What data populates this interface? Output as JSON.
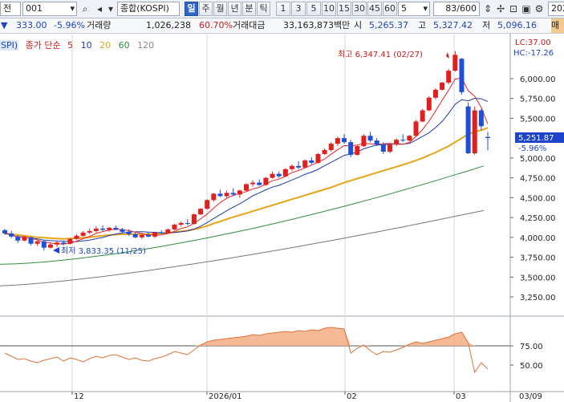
{
  "toolbar": {
    "mode_label": "전",
    "code": "001",
    "index_name": "종합(KOSPI)",
    "periods": [
      "일",
      "주",
      "월",
      "년",
      "분",
      "틱"
    ],
    "active_period": "일",
    "intervals": [
      "1",
      "3",
      "5",
      "10",
      "15",
      "30",
      "45",
      "60"
    ],
    "interval_value": "5",
    "count": "83/600",
    "date_cut": "202"
  },
  "quote": {
    "marker": "▼",
    "change": "333.00",
    "change_pct": "-5.96%",
    "volume_label": "거래량",
    "volume": "1,026,238",
    "volume_ratio": "60.70%",
    "amount_label": "거래대금",
    "amount": "33,163,873백만",
    "open_label": "시",
    "open": "5,265.37",
    "high_label": "고",
    "high": "5,327.42",
    "low_label": "저",
    "low": "5,096.16",
    "right_cut": "매"
  },
  "legend": {
    "tag": "SPI)",
    "ma_prefix": "종가 단순",
    "ma_periods": [
      "5",
      "10",
      "20",
      "60",
      "120"
    ]
  },
  "colors": {
    "up": "#e0201e",
    "down": "#1e4fd6",
    "ma5": "#e32626",
    "ma10": "#1f3aa8",
    "ma20": "#e8a418",
    "ma60": "#2e8f3a",
    "ma120": "#777777",
    "osc_fill": "#f4ad84",
    "osc_line": "#e0743a"
  },
  "price_axis": {
    "labels": [
      "6,000.00",
      "5,750.00",
      "5,500.00",
      "5,000.00",
      "4,750.00",
      "4,500.00",
      "4,250.00",
      "4,000.00",
      "3,750.00",
      "3,500.00",
      "3,250.00"
    ],
    "lc": "LC:37.00",
    "hc": "HC:-17.26",
    "current": "5,251.87",
    "current_pct": "-5.96%"
  },
  "annotations": {
    "high": "최고 6,347.41 (02/27)",
    "low": "최저 3,833.35 (11/25)"
  },
  "osc_axis": {
    "labels": [
      "75.00",
      "50.00"
    ]
  },
  "date_axis": {
    "labels": [
      "12",
      "2026/01",
      "02",
      "03",
      "03/09"
    ]
  },
  "chart_data": {
    "type": "candlestick",
    "dates": [
      "11/17",
      "11/18",
      "11/19",
      "11/20",
      "11/21",
      "11/24",
      "11/25",
      "11/26",
      "11/27",
      "11/28",
      "12/01",
      "12/02",
      "12/03",
      "12/04",
      "12/05",
      "12/08",
      "12/09",
      "12/10",
      "12/11",
      "12/12",
      "12/15",
      "12/16",
      "12/17",
      "12/18",
      "12/19",
      "12/22",
      "12/23",
      "12/24",
      "12/26",
      "12/29",
      "12/30",
      "01/02",
      "01/05",
      "01/06",
      "01/07",
      "01/08",
      "01/09",
      "01/12",
      "01/13",
      "01/14",
      "01/15",
      "01/16",
      "01/19",
      "01/20",
      "01/21",
      "01/22",
      "01/23",
      "01/26",
      "01/27",
      "01/28",
      "01/29",
      "01/30",
      "02/02",
      "02/03",
      "02/04",
      "02/05",
      "02/06",
      "02/09",
      "02/10",
      "02/11",
      "02/12",
      "02/13",
      "02/18",
      "02/19",
      "02/20",
      "02/23",
      "02/24",
      "02/25",
      "02/26",
      "02/27",
      "03/03",
      "03/04",
      "03/05",
      "03/06",
      "03/09"
    ],
    "ohlc": [
      [
        4090,
        4110,
        4030,
        4050
      ],
      [
        4050,
        4080,
        3990,
        4010
      ],
      [
        4010,
        4030,
        3930,
        3960
      ],
      [
        3960,
        4020,
        3950,
        4000
      ],
      [
        4000,
        4010,
        3900,
        3920
      ],
      [
        3920,
        3960,
        3890,
        3950
      ],
      [
        3950,
        3960,
        3833.35,
        3870
      ],
      [
        3870,
        3930,
        3860,
        3910
      ],
      [
        3910,
        3950,
        3880,
        3935
      ],
      [
        3935,
        3960,
        3900,
        3920
      ],
      [
        3920,
        3990,
        3910,
        3980
      ],
      [
        3980,
        4040,
        3970,
        4020
      ],
      [
        4020,
        4080,
        4010,
        4060
      ],
      [
        4060,
        4110,
        4040,
        4080
      ],
      [
        4080,
        4140,
        4060,
        4110
      ],
      [
        4110,
        4150,
        4080,
        4095
      ],
      [
        4095,
        4130,
        4070,
        4120
      ],
      [
        4120,
        4150,
        4090,
        4100
      ],
      [
        4100,
        4120,
        4050,
        4070
      ],
      [
        4070,
        4100,
        4020,
        4040
      ],
      [
        4040,
        4060,
        3990,
        4000
      ],
      [
        4000,
        4050,
        3980,
        4030
      ],
      [
        4030,
        4060,
        4000,
        4010
      ],
      [
        4010,
        4070,
        3990,
        4060
      ],
      [
        4060,
        4090,
        4040,
        4050
      ],
      [
        4050,
        4110,
        4040,
        4100
      ],
      [
        4100,
        4170,
        4090,
        4160
      ],
      [
        4160,
        4200,
        4140,
        4180
      ],
      [
        4180,
        4230,
        4150,
        4170
      ],
      [
        4170,
        4300,
        4160,
        4290
      ],
      [
        4290,
        4370,
        4280,
        4360
      ],
      [
        4360,
        4480,
        4350,
        4470
      ],
      [
        4470,
        4560,
        4450,
        4550
      ],
      [
        4550,
        4600,
        4510,
        4520
      ],
      [
        4520,
        4590,
        4500,
        4560
      ],
      [
        4560,
        4620,
        4520,
        4540
      ],
      [
        4540,
        4600,
        4500,
        4590
      ],
      [
        4590,
        4680,
        4580,
        4670
      ],
      [
        4670,
        4720,
        4640,
        4690
      ],
      [
        4690,
        4730,
        4650,
        4660
      ],
      [
        4660,
        4760,
        4650,
        4750
      ],
      [
        4750,
        4830,
        4740,
        4800
      ],
      [
        4800,
        4830,
        4750,
        4770
      ],
      [
        4770,
        4870,
        4760,
        4860
      ],
      [
        4860,
        4920,
        4840,
        4900
      ],
      [
        4900,
        4960,
        4860,
        4880
      ],
      [
        4880,
        4980,
        4870,
        4970
      ],
      [
        4970,
        5010,
        4920,
        4940
      ],
      [
        4940,
        5060,
        4930,
        5050
      ],
      [
        5050,
        5120,
        5040,
        5100
      ],
      [
        5100,
        5200,
        5080,
        5180
      ],
      [
        5180,
        5270,
        5150,
        5250
      ],
      [
        5250,
        5300,
        5180,
        5200
      ],
      [
        5200,
        5230,
        5010,
        5040
      ],
      [
        5040,
        5160,
        5030,
        5150
      ],
      [
        5150,
        5300,
        5140,
        5280
      ],
      [
        5280,
        5330,
        5200,
        5220
      ],
      [
        5220,
        5250,
        5150,
        5170
      ],
      [
        5170,
        5200,
        5050,
        5080
      ],
      [
        5080,
        5180,
        5060,
        5170
      ],
      [
        5170,
        5250,
        5150,
        5230
      ],
      [
        5230,
        5300,
        5200,
        5220
      ],
      [
        5220,
        5290,
        5210,
        5280
      ],
      [
        5280,
        5480,
        5270,
        5460
      ],
      [
        5460,
        5620,
        5450,
        5600
      ],
      [
        5600,
        5780,
        5590,
        5760
      ],
      [
        5760,
        5880,
        5740,
        5860
      ],
      [
        5860,
        5960,
        5850,
        5950
      ],
      [
        5950,
        6120,
        5930,
        6100
      ],
      [
        6100,
        6347.41,
        6090,
        6300
      ],
      [
        6250,
        6260,
        5800,
        5830
      ],
      [
        5650,
        5700,
        5050,
        5060
      ],
      [
        5060,
        5650,
        5040,
        5600
      ],
      [
        5600,
        5620,
        5350,
        5400
      ],
      [
        5265.37,
        5327.42,
        5096.16,
        5251.87
      ]
    ],
    "ma20": [
      4050,
      4040,
      4030,
      4020,
      4010,
      4000,
      3995,
      3990,
      3985,
      3980,
      3985,
      3990,
      3995,
      4000,
      4010,
      4020,
      4030,
      4035,
      4040,
      4040,
      4040,
      4040,
      4040,
      4045,
      4050,
      4055,
      4065,
      4075,
      4085,
      4100,
      4120,
      4145,
      4175,
      4200,
      4230,
      4255,
      4280,
      4305,
      4330,
      4355,
      4380,
      4405,
      4430,
      4455,
      4480,
      4505,
      4530,
      4555,
      4580,
      4605,
      4630,
      4660,
      4690,
      4715,
      4740,
      4765,
      4790,
      4815,
      4840,
      4865,
      4890,
      4915,
      4940,
      4970,
      5000,
      5035,
      5070,
      5110,
      5150,
      5200,
      5250,
      5300,
      5330,
      5350,
      5380
    ],
    "ma60_range": [
      3660,
      4900
    ],
    "ma120_range": [
      3390,
      4340
    ],
    "oscillator": {
      "levels": [
        "75.00",
        "50.00"
      ]
    }
  }
}
